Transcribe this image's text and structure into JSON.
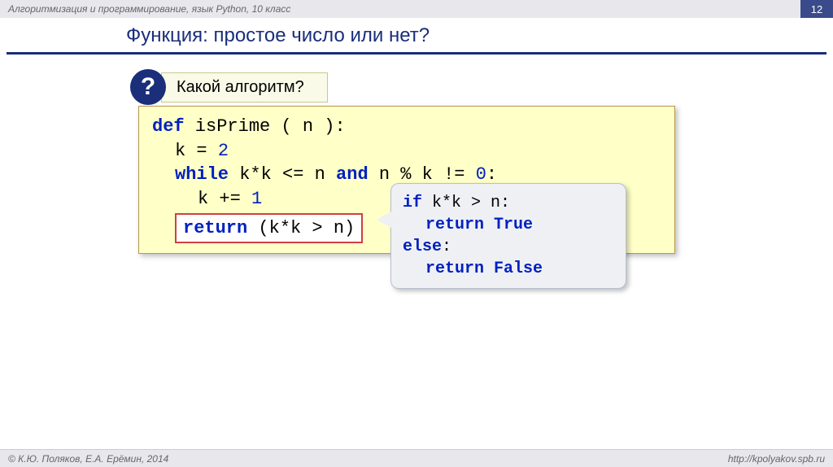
{
  "header": {
    "course": "Алгоритмизация и программирование, язык Python, 10 класс",
    "page": "12"
  },
  "title": "Функция: простое число или нет?",
  "question": {
    "mark": "?",
    "label": "Какой алгоритм?"
  },
  "code": {
    "l1_def": "def",
    "l1_rest": " isPrime ( n ):",
    "l2_a": "k = ",
    "l2_b": "2",
    "l3_while": "while",
    "l3_mid": " k*k <= n ",
    "l3_and": "and",
    "l3_end": " n % k != ",
    "l3_zero": "0",
    "l3_colon": ":",
    "l4_a": "k += ",
    "l4_b": "1",
    "ret_kw": "return",
    "ret_expr": " (k*k > n)"
  },
  "callout": {
    "l1_if": "if",
    "l1_rest": " k*k > n:",
    "l2_ret": "return",
    "l2_val": " True",
    "l3_else": "else",
    "l3_colon": ":",
    "l4_ret": "return",
    "l4_val": " False"
  },
  "footer": {
    "left": "© К.Ю. Поляков, Е.А. Ерёмин, 2014",
    "right": "http://kpolyakov.spb.ru"
  }
}
